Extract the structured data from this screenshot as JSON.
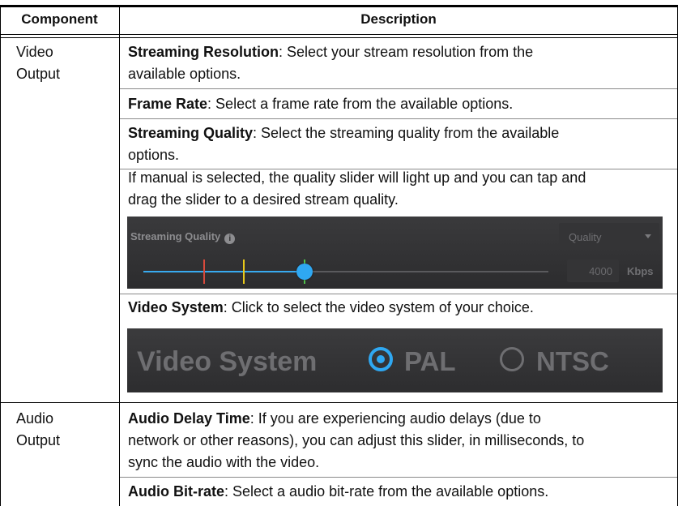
{
  "header": {
    "component": "Component",
    "description": "Description"
  },
  "rows": [
    {
      "component": [
        "Video",
        "Output"
      ],
      "items": [
        {
          "bold": "Streaming Resolution",
          "text_lines": [
            ": Select your stream resolution from the",
            "available options."
          ]
        },
        {
          "bold": "Frame Rate",
          "text": ": Select a frame rate from the available options."
        },
        {
          "bold": "Streaming Quality",
          "text_lines": [
            ": Select the streaming quality from the available",
            "options."
          ]
        },
        {
          "text_lines": [
            "If manual is selected, the quality slider will light up and you can tap and",
            "drag the slider to a desired stream quality."
          ]
        },
        {
          "bold": "Video System",
          "text": ": Click to select the video system of your choice."
        }
      ]
    },
    {
      "component": [
        "Audio",
        "Output"
      ],
      "items": [
        {
          "bold": "Audio Delay Time",
          "text_lines": [
            ": If you are experiencing audio delays (due to",
            "network or other reasons), you can adjust this slider, in milliseconds, to",
            "sync the audio with the video."
          ]
        },
        {
          "bold": "Audio Bit-rate",
          "text": ": Select a audio bit-rate from the available options."
        }
      ]
    }
  ],
  "streaming_quality_panel": {
    "title": "Streaming Quality",
    "info_icon": "info-icon",
    "select_value": "Quality",
    "bitrate_value": "4000",
    "bitrate_unit": "Kbps",
    "slider_level_fraction": 0.4,
    "tick_colors": [
      "#d84a3c",
      "#e8c81a",
      "#4ec24a"
    ],
    "accent": "#2fa8f2"
  },
  "video_system_panel": {
    "title": "Video System",
    "options": [
      "PAL",
      "NTSC"
    ],
    "selected": "PAL",
    "accent": "#2fa8f2"
  }
}
